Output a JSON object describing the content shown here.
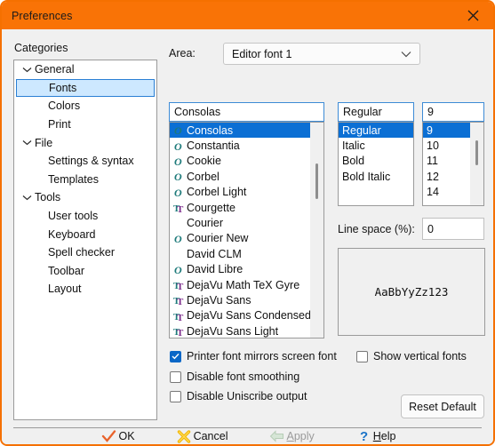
{
  "window": {
    "title": "Preferences",
    "accent_color": "#f97306",
    "close_icon": "close-icon"
  },
  "categories": {
    "label": "Categories",
    "items": [
      {
        "label": "General",
        "type": "group",
        "expanded": true,
        "selected": false
      },
      {
        "label": "Fonts",
        "type": "child",
        "expanded": false,
        "selected": true
      },
      {
        "label": "Colors",
        "type": "child",
        "expanded": false,
        "selected": false
      },
      {
        "label": "Print",
        "type": "child",
        "expanded": false,
        "selected": false
      },
      {
        "label": "File",
        "type": "group",
        "expanded": true,
        "selected": false
      },
      {
        "label": "Settings & syntax",
        "type": "child",
        "expanded": false,
        "selected": false
      },
      {
        "label": "Templates",
        "type": "child",
        "expanded": false,
        "selected": false
      },
      {
        "label": "Tools",
        "type": "group",
        "expanded": true,
        "selected": false
      },
      {
        "label": "User tools",
        "type": "child",
        "expanded": false,
        "selected": false
      },
      {
        "label": "Keyboard",
        "type": "child",
        "expanded": false,
        "selected": false
      },
      {
        "label": "Spell checker",
        "type": "child",
        "expanded": false,
        "selected": false
      },
      {
        "label": "Toolbar",
        "type": "child",
        "expanded": false,
        "selected": false
      },
      {
        "label": "Layout",
        "type": "child",
        "expanded": false,
        "selected": false
      }
    ]
  },
  "area": {
    "label": "Area:",
    "selected": "Editor font 1",
    "arrow_icon": "chevron-down-icon"
  },
  "font_name": {
    "value": "Consolas",
    "items": [
      {
        "label": "Consolas",
        "icon": "opentype-icon",
        "selected": true
      },
      {
        "label": "Constantia",
        "icon": "opentype-icon",
        "selected": false
      },
      {
        "label": "Cookie",
        "icon": "opentype-icon",
        "selected": false
      },
      {
        "label": "Corbel",
        "icon": "opentype-icon",
        "selected": false
      },
      {
        "label": "Corbel Light",
        "icon": "opentype-icon",
        "selected": false
      },
      {
        "label": "Courgette",
        "icon": "truetype-icon",
        "selected": false
      },
      {
        "label": "Courier",
        "icon": "none",
        "selected": false
      },
      {
        "label": "Courier New",
        "icon": "opentype-icon",
        "selected": false
      },
      {
        "label": "David CLM",
        "icon": "none",
        "selected": false
      },
      {
        "label": "David Libre",
        "icon": "opentype-icon",
        "selected": false
      },
      {
        "label": "DejaVu Math TeX Gyre",
        "icon": "truetype-icon",
        "selected": false
      },
      {
        "label": "DejaVu Sans",
        "icon": "truetype-icon",
        "selected": false
      },
      {
        "label": "DejaVu Sans Condensed",
        "icon": "truetype-icon",
        "selected": false
      },
      {
        "label": "DejaVu Sans Light",
        "icon": "truetype-icon",
        "selected": false
      }
    ]
  },
  "font_style": {
    "value": "Regular",
    "items": [
      {
        "label": "Regular",
        "selected": true
      },
      {
        "label": "Italic",
        "selected": false
      },
      {
        "label": "Bold",
        "selected": false
      },
      {
        "label": "Bold Italic",
        "selected": false
      }
    ]
  },
  "font_size": {
    "value": "9",
    "items": [
      {
        "label": "9",
        "selected": true
      },
      {
        "label": "10",
        "selected": false
      },
      {
        "label": "11",
        "selected": false
      },
      {
        "label": "12",
        "selected": false
      },
      {
        "label": "14",
        "selected": false
      }
    ]
  },
  "line_space": {
    "label": "Line space (%):",
    "value": "0"
  },
  "preview": {
    "sample_text": "AaBbYyZz123"
  },
  "options": [
    {
      "label": "Printer font mirrors screen font",
      "checked": true
    },
    {
      "label": "Show vertical fonts",
      "checked": false
    },
    {
      "label": "Disable font smoothing",
      "checked": false
    },
    {
      "label": "Disable Uniscribe output",
      "checked": false
    }
  ],
  "reset_button": {
    "label": "Reset Default"
  },
  "footer": {
    "ok": {
      "label": "OK",
      "icon": "checkmark-icon",
      "disabled": false
    },
    "cancel": {
      "label": "Cancel",
      "icon": "x-mark-icon",
      "disabled": false
    },
    "apply": {
      "label": "Apply",
      "icon": "arrow-left-icon",
      "disabled": true,
      "accel": "A",
      "rest": "pply"
    },
    "help": {
      "label": "Help",
      "icon": "question-icon",
      "disabled": false,
      "accel": "H",
      "rest": "elp"
    }
  }
}
